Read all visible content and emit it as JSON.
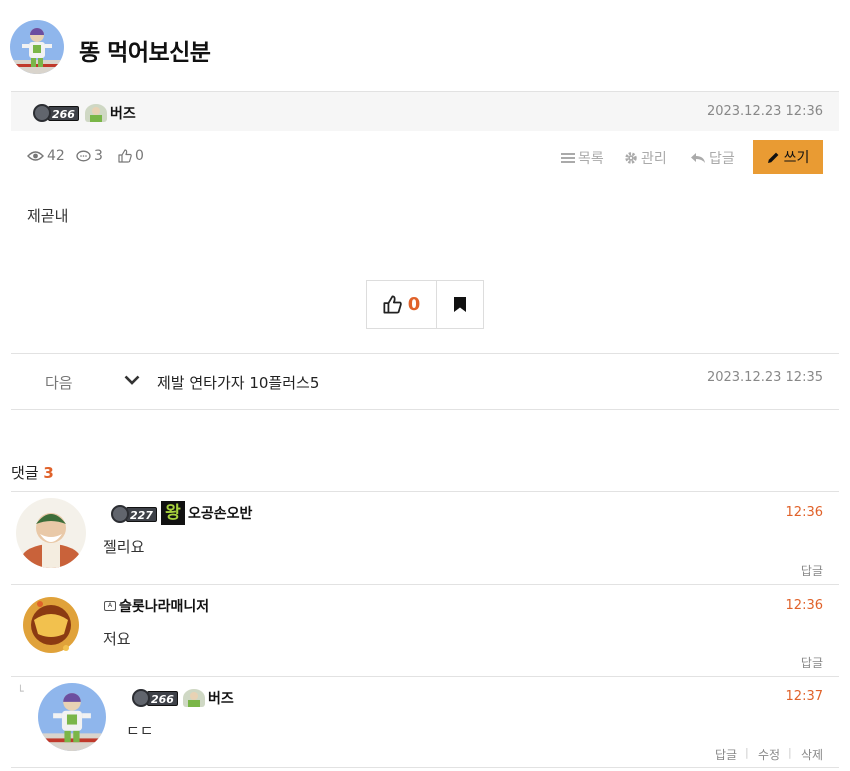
{
  "post": {
    "title": "똥 먹어보신분",
    "author": {
      "level": "266",
      "nickname": "버즈"
    },
    "date": "2023.12.23 12:36",
    "stats": {
      "views": "42",
      "comments": "3",
      "likes": "0"
    },
    "toolbar": {
      "list": "목록",
      "manage": "관리",
      "reply": "답글",
      "write": "쓰기"
    },
    "body": "제곧내",
    "vote": {
      "likes": "0"
    }
  },
  "next": {
    "label": "다음",
    "title": "제발 연타가자 10플러스5",
    "date": "2023.12.23 12:35"
  },
  "comments_section": {
    "heading": "댓글",
    "count": "3",
    "items": [
      {
        "level": "227",
        "badge": "왕",
        "nickname": "오공손오반",
        "time": "12:36",
        "text": "젤리요",
        "actions": [
          "답글"
        ]
      },
      {
        "nickname": "슬롯나라매니저",
        "time": "12:36",
        "text": "저요",
        "actions": [
          "답글"
        ]
      },
      {
        "level": "266",
        "nickname": "버즈",
        "time": "12:37",
        "text": "ㄷㄷ",
        "actions": [
          "답글",
          "수정",
          "삭제"
        ]
      }
    ]
  },
  "colors": {
    "accent": "#e99b33",
    "highlight": "#e0622a"
  }
}
